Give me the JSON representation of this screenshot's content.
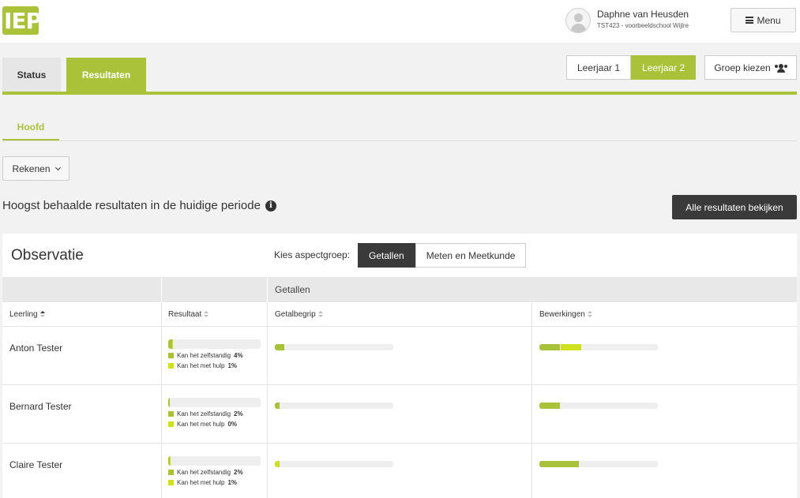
{
  "colors": {
    "accent": "#a9c23a",
    "zelfstandig": "#a9c23a",
    "hulp": "#cfe01c",
    "dark": "#3a3a3a",
    "track": "#eeeeee"
  },
  "header": {
    "logo": "IEP",
    "user_name": "Daphne van Heusden",
    "user_school": "TST423 - voorbeeldschool Wijlre",
    "menu_label": "Menu",
    "menu_icon": "hamburger-icon",
    "avatar_icon": "user-avatar-icon"
  },
  "tabs": {
    "status": "Status",
    "resultaten": "Resultaten",
    "active": "Resultaten"
  },
  "years": {
    "items": [
      "Leerjaar 1",
      "Leerjaar 2"
    ],
    "active": "Leerjaar 2"
  },
  "groep": {
    "label": "Groep kiezen",
    "icon": "users-icon"
  },
  "subtab": {
    "label": "Hoofd"
  },
  "subject": {
    "label": "Rekenen",
    "icon": "chevron-down-icon"
  },
  "section": {
    "title": "Hoogst behaalde resultaten in de huidige periode",
    "info_icon": "info-icon",
    "all_results_label": "Alle resultaten bekijken"
  },
  "panel": {
    "title": "Observatie",
    "aspect_label": "Kies aspectgroep:",
    "aspect_options": [
      "Getallen",
      "Meten en Meetkunde"
    ],
    "aspect_active": "Getallen",
    "group_header": "Getallen",
    "columns": [
      "Leerling",
      "Resultaat",
      "Getalbegrip",
      "Bewerkingen"
    ],
    "sorted_column": "Leerling"
  },
  "legend_labels": {
    "zelfstandig": "Kan het zelfstandig",
    "hulp": "Kan het met hulp"
  },
  "students": [
    {
      "name": "Anton Tester",
      "zelfstandig": "4%",
      "hulp": "1%",
      "zelfstandig_frac": 0.04,
      "hulp_frac": 0.01,
      "getalbegrip": [
        {
          "kind": "zelfstandig",
          "frac": 0.08
        }
      ],
      "bewerkingen": [
        {
          "kind": "zelfstandig",
          "frac": 0.17
        },
        {
          "kind": "hulp",
          "frac": 0.17
        }
      ]
    },
    {
      "name": "Bernard Tester",
      "zelfstandig": "2%",
      "hulp": "0%",
      "zelfstandig_frac": 0.02,
      "hulp_frac": 0.0,
      "getalbegrip": [
        {
          "kind": "zelfstandig",
          "frac": 0.04
        }
      ],
      "bewerkingen": [
        {
          "kind": "zelfstandig",
          "frac": 0.17
        }
      ]
    },
    {
      "name": "Claire Tester",
      "zelfstandig": "2%",
      "hulp": "1%",
      "zelfstandig_frac": 0.02,
      "hulp_frac": 0.01,
      "getalbegrip": [
        {
          "kind": "hulp",
          "frac": 0.04
        }
      ],
      "bewerkingen": [
        {
          "kind": "zelfstandig",
          "frac": 0.33
        }
      ]
    }
  ]
}
